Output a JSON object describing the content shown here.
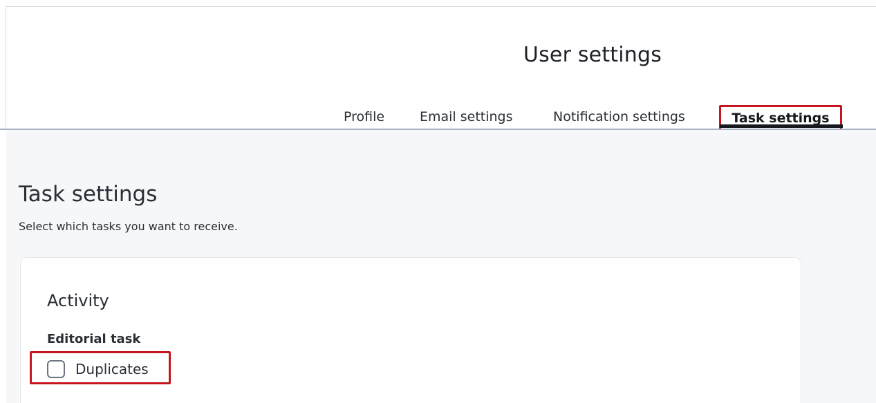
{
  "header": {
    "title": "User settings",
    "tabs": [
      {
        "label": "Profile",
        "active": false
      },
      {
        "label": "Email settings",
        "active": false
      },
      {
        "label": "Notification settings",
        "active": false
      },
      {
        "label": "Task settings",
        "active": true
      }
    ]
  },
  "main": {
    "title": "Task settings",
    "description": "Select which tasks you want to receive.",
    "card": {
      "title": "Activity",
      "groups": [
        {
          "label": "Editorial task",
          "options": [
            {
              "label": "Duplicates",
              "checked": false
            }
          ]
        }
      ]
    }
  },
  "colors": {
    "highlight": "#c4161c",
    "active_tab_underline": "#15181c",
    "content_background": "#f6f7f9",
    "header_border": "#a9b1c2"
  }
}
